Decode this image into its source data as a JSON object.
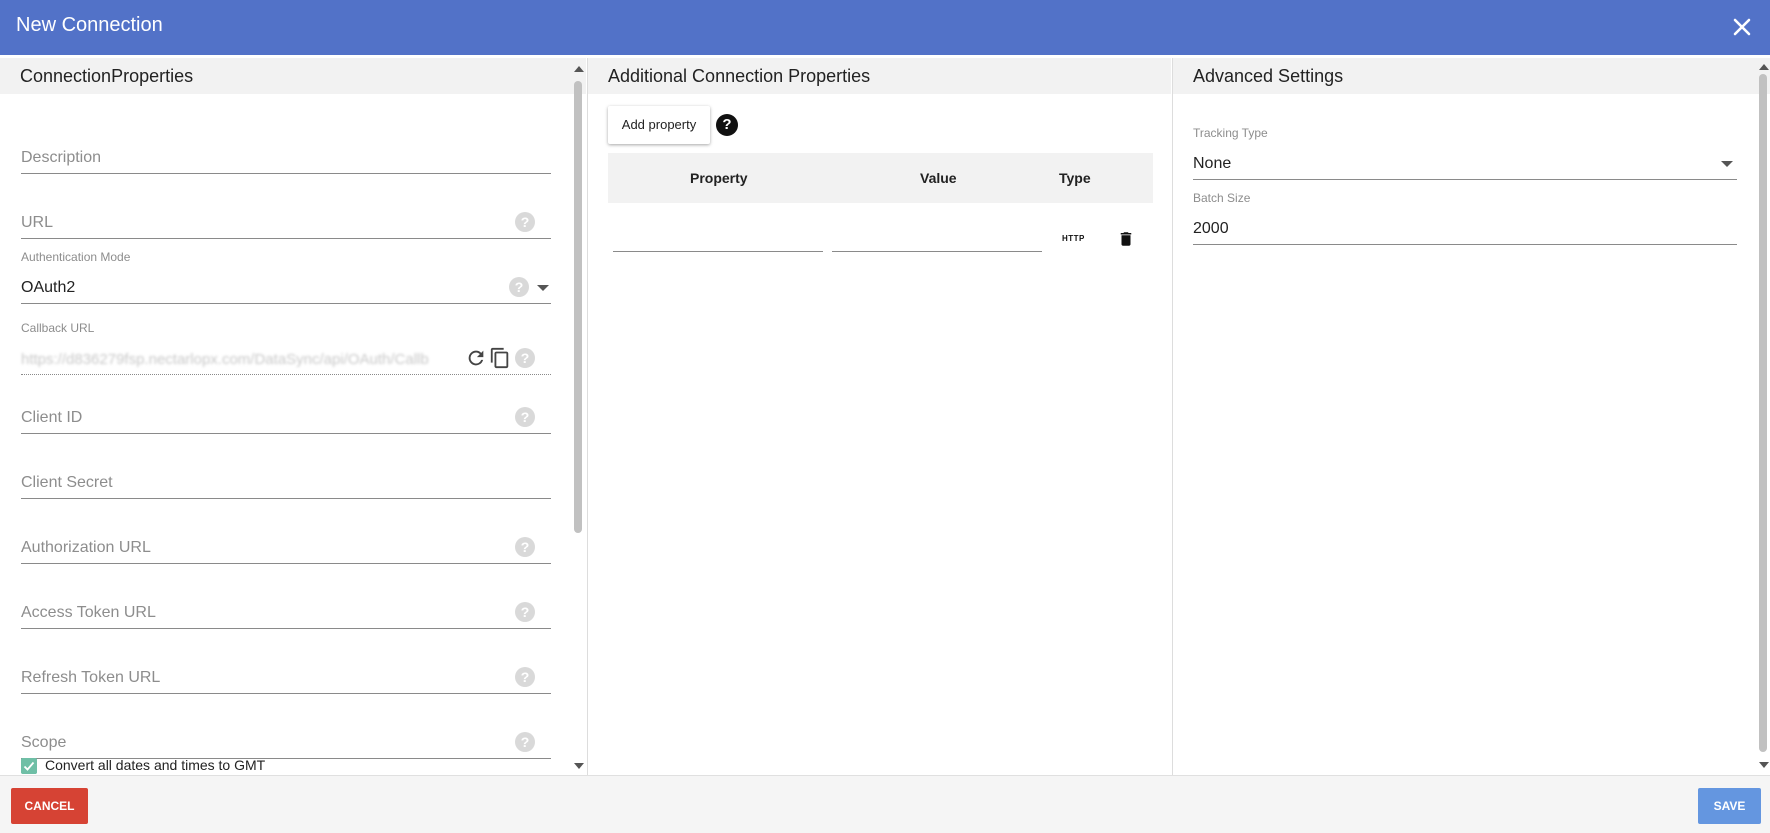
{
  "dialog": {
    "title": "New Connection"
  },
  "left": {
    "heading": "ConnectionProperties",
    "description_placeholder": "Description",
    "url_placeholder": "URL",
    "auth_mode_label": "Authentication Mode",
    "auth_mode_value": "OAuth2",
    "callback_label": "Callback URL",
    "callback_value": "https://d836279fsp.nectarlopx.com/DataSync/api/OAuth/Callb",
    "client_id_placeholder": "Client ID",
    "client_secret_placeholder": "Client Secret",
    "authorization_url_placeholder": "Authorization URL",
    "access_token_url_placeholder": "Access Token URL",
    "refresh_token_url_placeholder": "Refresh Token URL",
    "scope_placeholder": "Scope",
    "convert_dates_label": "Convert all dates and times to GMT",
    "convert_dates_checked": true
  },
  "middle": {
    "heading": "Additional Connection Properties",
    "add_property_label": "Add property",
    "columns": [
      "Property",
      "Value",
      "Type"
    ],
    "row_type": "HTTP"
  },
  "right": {
    "heading": "Advanced Settings",
    "tracking_type_label": "Tracking Type",
    "tracking_type_value": "None",
    "batch_size_label": "Batch Size",
    "batch_size_value": "2000"
  },
  "footer": {
    "cancel_label": "CANCEL",
    "save_label": "SAVE"
  },
  "icons": {
    "help": "question-circle-icon",
    "close": "close-icon",
    "refresh": "refresh-icon",
    "copy": "copy-icon",
    "trash": "trash-icon"
  },
  "colors": {
    "titlebar": "#5272c8",
    "cancel": "#d64334",
    "save": "#6496e0",
    "checkbox": "#6fbfa6"
  }
}
